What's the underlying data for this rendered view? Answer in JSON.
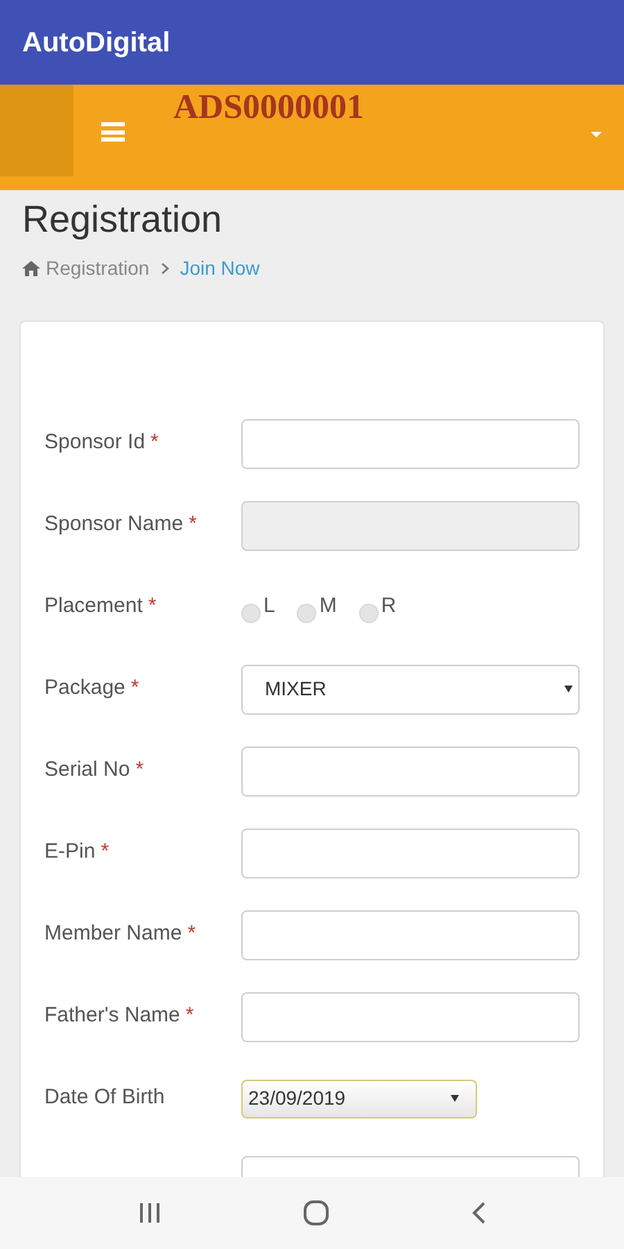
{
  "app_bar": {
    "title": "AutoDigital"
  },
  "top_bar": {
    "user_id": "ADS0000001"
  },
  "page": {
    "title": "Registration",
    "breadcrumb": [
      {
        "label": "Registration",
        "selected": false
      },
      {
        "label": "Join Now",
        "selected": true
      }
    ]
  },
  "form": {
    "fields": [
      {
        "kind": "text",
        "label": "Sponsor Id",
        "required_mark": "*"
      },
      {
        "kind": "disabled",
        "label": "Sponsor Name",
        "required_mark": "*"
      },
      {
        "kind": "radio",
        "label": "Placement",
        "required_mark": "*",
        "options": [
          {
            "label": "L",
            "selected": false
          },
          {
            "label": "M",
            "selected": false
          },
          {
            "label": "R",
            "selected": false
          }
        ]
      },
      {
        "kind": "select",
        "label": "Package",
        "required_mark": "*",
        "value": "MIXER"
      },
      {
        "kind": "text",
        "label": "Serial No",
        "required_mark": "*"
      },
      {
        "kind": "text",
        "label": "E-Pin",
        "required_mark": "*"
      },
      {
        "kind": "text",
        "label": "Member Name",
        "required_mark": "*"
      },
      {
        "kind": "text",
        "label": "Father's Name",
        "required_mark": "*"
      },
      {
        "kind": "date",
        "label": "Date Of Birth",
        "value": "23/09/2019"
      },
      {
        "kind": "text"
      }
    ]
  }
}
